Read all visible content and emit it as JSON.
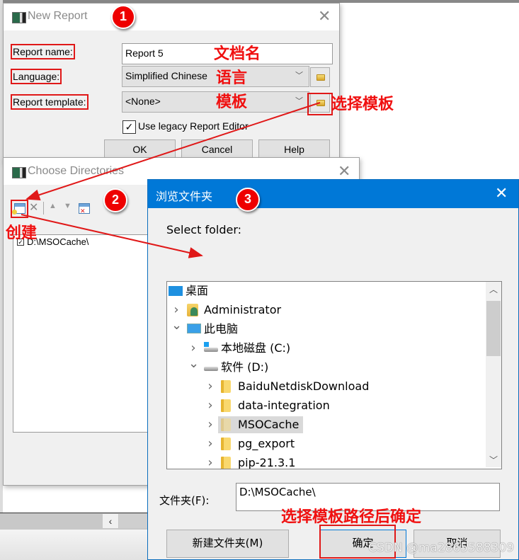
{
  "new_report": {
    "title": "New Report",
    "report_name_label": "Report name:",
    "report_name_value": "Report 5",
    "language_label": "Language:",
    "language_value": "Simplified Chinese",
    "template_label": "Report template:",
    "template_value": "<None>",
    "legacy_checkbox_label": "Use legacy Report Editor",
    "legacy_checked": true,
    "ok_label": "OK",
    "cancel_label": "Cancel",
    "help_label": "Help",
    "icons": {
      "folder": "folder-icon",
      "dropdown": "chevron-down-icon",
      "close": "close-icon"
    }
  },
  "choose_directories": {
    "title": "Choose Directories",
    "toolbar": [
      "add-directory-icon",
      "delete-icon",
      "move-up-icon",
      "move-down-icon",
      "remove-invalid-icon"
    ],
    "items": [
      {
        "path": "D:\\MSOCache\\",
        "checked": true
      }
    ]
  },
  "browse_folder": {
    "title": "浏览文件夹",
    "prompt": "Select folder:",
    "tree": [
      {
        "label": "桌面",
        "level": 0,
        "expander": "",
        "icon": "desktop-icon"
      },
      {
        "label": "Administrator",
        "level": 1,
        "expander": ">",
        "icon": "user-folder-icon"
      },
      {
        "label": "此电脑",
        "level": 1,
        "expander": "v",
        "icon": "computer-icon"
      },
      {
        "label": "本地磁盘 (C:)",
        "level": 2,
        "expander": ">",
        "icon": "system-drive-icon"
      },
      {
        "label": "软件 (D:)",
        "level": 2,
        "expander": "v",
        "icon": "drive-icon"
      },
      {
        "label": "BaiduNetdiskDownload",
        "level": 3,
        "expander": ">",
        "icon": "folder-icon"
      },
      {
        "label": "data-integration",
        "level": 3,
        "expander": ">",
        "icon": "folder-icon"
      },
      {
        "label": "MSOCache",
        "level": 3,
        "expander": ">",
        "icon": "folder-icon",
        "selected": true
      },
      {
        "label": "pg_export",
        "level": 3,
        "expander": ">",
        "icon": "folder-icon"
      },
      {
        "label": "pip-21.3.1",
        "level": 3,
        "expander": ">",
        "icon": "folder-icon"
      }
    ],
    "folder_label": "文件夹(F):",
    "folder_value": "D:\\MSOCache\\",
    "new_folder_label": "新建文件夹(M)",
    "ok_label": "确定",
    "cancel_label": "取消"
  },
  "annotations": {
    "badge1": "1",
    "badge2": "2",
    "badge3": "3",
    "doc_name": "文档名",
    "language": "语言",
    "template": "模板",
    "select_template": "选择模板",
    "create": "创建",
    "confirm": "选择模板路径后确定",
    "color": "#e01818"
  },
  "watermark": "CSDN @ma2865588309"
}
